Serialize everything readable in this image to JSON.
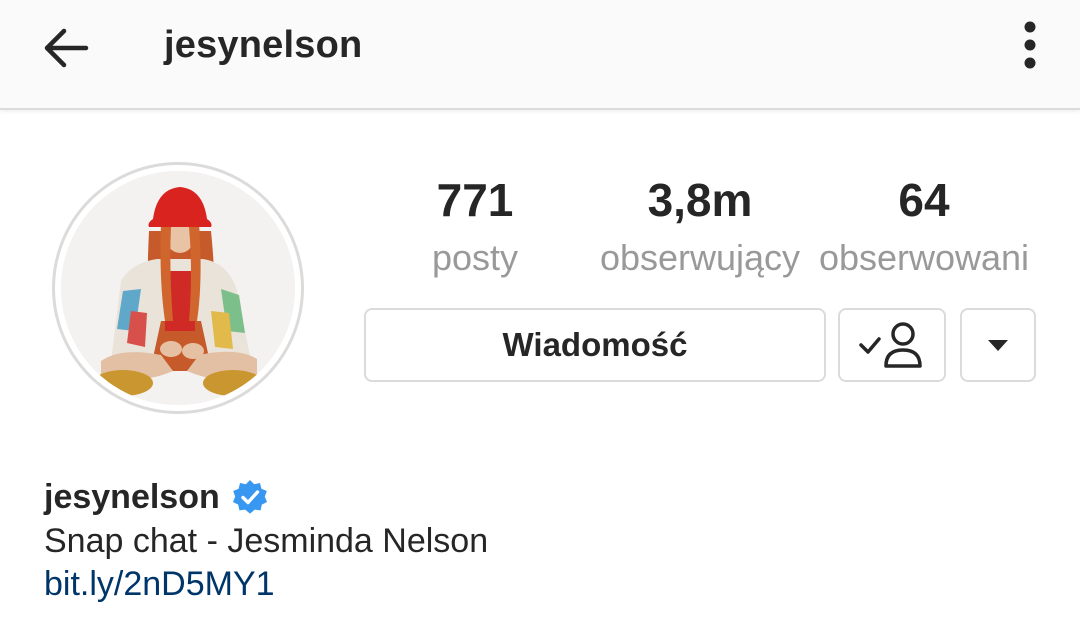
{
  "header": {
    "username": "jesynelson",
    "back_icon": "arrow-left-icon",
    "more_icon": "more-vertical-icon"
  },
  "profile": {
    "avatar_alt": "profile photo",
    "stats": {
      "posts_count": "771",
      "posts_label": "posty",
      "followers_count": "3,8m",
      "followers_label": "obserwujący",
      "following_count": "64",
      "following_label": "obserwowani"
    },
    "buttons": {
      "message_label": "Wiadomość",
      "following_icon": "user-check-icon",
      "dropdown_icon": "caret-down-icon"
    },
    "bio": {
      "name": "jesynelson",
      "verified_icon": "verified-badge-icon",
      "text": "Snap chat - Jesminda Nelson",
      "link": "bit.ly/2nD5MY1"
    }
  },
  "colors": {
    "text": "#262626",
    "secondary_text": "#999999",
    "border": "#dbdbdb",
    "link": "#003569",
    "verified": "#3897f0",
    "appbar_bg": "#fafafa"
  }
}
